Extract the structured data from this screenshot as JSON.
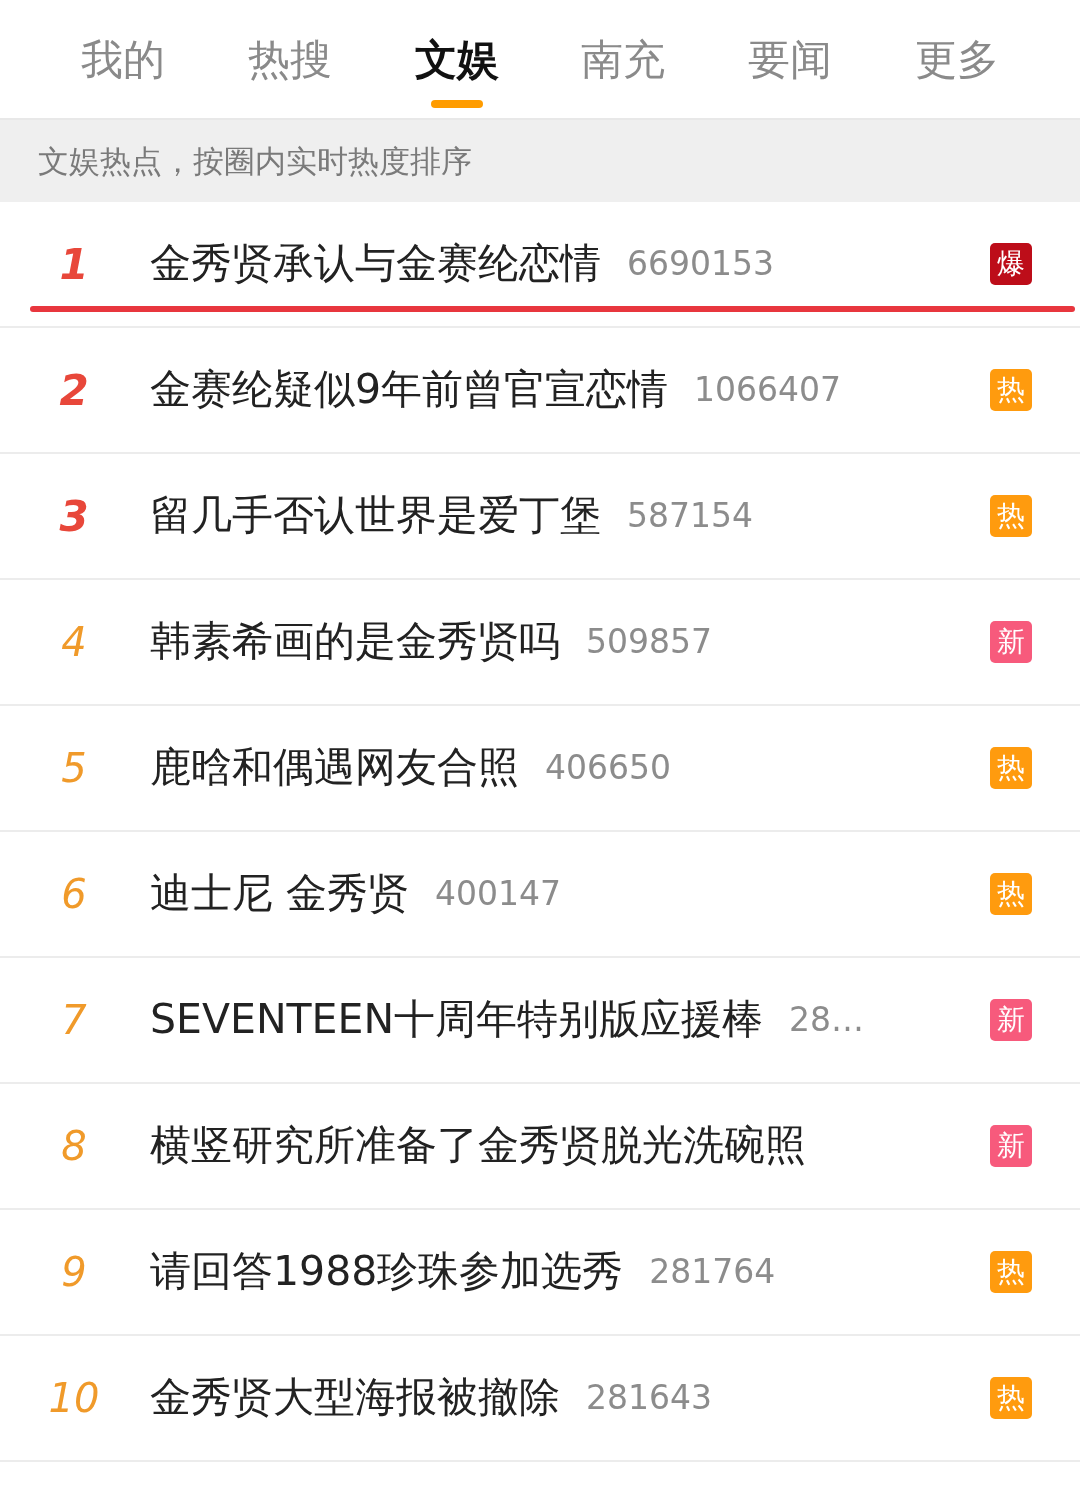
{
  "tabs": [
    {
      "label": "我的",
      "selected": false
    },
    {
      "label": "热搜",
      "selected": false
    },
    {
      "label": "文娱",
      "selected": true
    },
    {
      "label": "南充",
      "selected": false
    },
    {
      "label": "要闻",
      "selected": false
    },
    {
      "label": "更多",
      "selected": false
    }
  ],
  "subtitle": "文娱热点，按圈内实时热度排序",
  "items": [
    {
      "rank": "1",
      "color": "#e8473a",
      "title": "金秀贤承认与金赛纶恋情",
      "count": "6690153",
      "badge": {
        "text": "爆",
        "color": "#bd0d19"
      },
      "underlined": true
    },
    {
      "rank": "2",
      "color": "#e8473a",
      "title": "金赛纶疑似9年前曾官宣恋情",
      "count": "1066407",
      "badge": {
        "text": "热",
        "color": "#ff9b0e"
      },
      "underlined": false
    },
    {
      "rank": "3",
      "color": "#e8473a",
      "title": "留几手否认世界是爱丁堡",
      "count": "587154",
      "badge": {
        "text": "热",
        "color": "#ff9b0e"
      },
      "underlined": false
    },
    {
      "rank": "4",
      "color": "#f09a2a",
      "title": "韩素希画的是金秀贤吗",
      "count": "509857",
      "badge": {
        "text": "新",
        "color": "#f75a7c"
      },
      "underlined": false
    },
    {
      "rank": "5",
      "color": "#f09a2a",
      "title": "鹿晗和偶遇网友合照",
      "count": "406650",
      "badge": {
        "text": "热",
        "color": "#ff9b0e"
      },
      "underlined": false
    },
    {
      "rank": "6",
      "color": "#f09a2a",
      "title": "迪士尼 金秀贤",
      "count": "400147",
      "badge": {
        "text": "热",
        "color": "#ff9b0e"
      },
      "underlined": false
    },
    {
      "rank": "7",
      "color": "#f09a2a",
      "title": "SEVENTEEN十周年特别版应援棒",
      "count": "28…",
      "badge": {
        "text": "新",
        "color": "#f75a7c"
      },
      "underlined": false
    },
    {
      "rank": "8",
      "color": "#f09a2a",
      "title": "横竖研究所准备了金秀贤脱光洗碗照",
      "badge": {
        "text": "新",
        "color": "#f75a7c"
      },
      "underlined": false
    },
    {
      "rank": "9",
      "color": "#f09a2a",
      "title": "请回答1988珍珠参加选秀",
      "count": "281764",
      "badge": {
        "text": "热",
        "color": "#ff9b0e"
      },
      "underlined": false
    },
    {
      "rank": "10",
      "color": "#f09a2a",
      "title": "金秀贤大型海报被撤除",
      "count": "281643",
      "badge": {
        "text": "热",
        "color": "#ff9b0e"
      },
      "underlined": false
    }
  ]
}
